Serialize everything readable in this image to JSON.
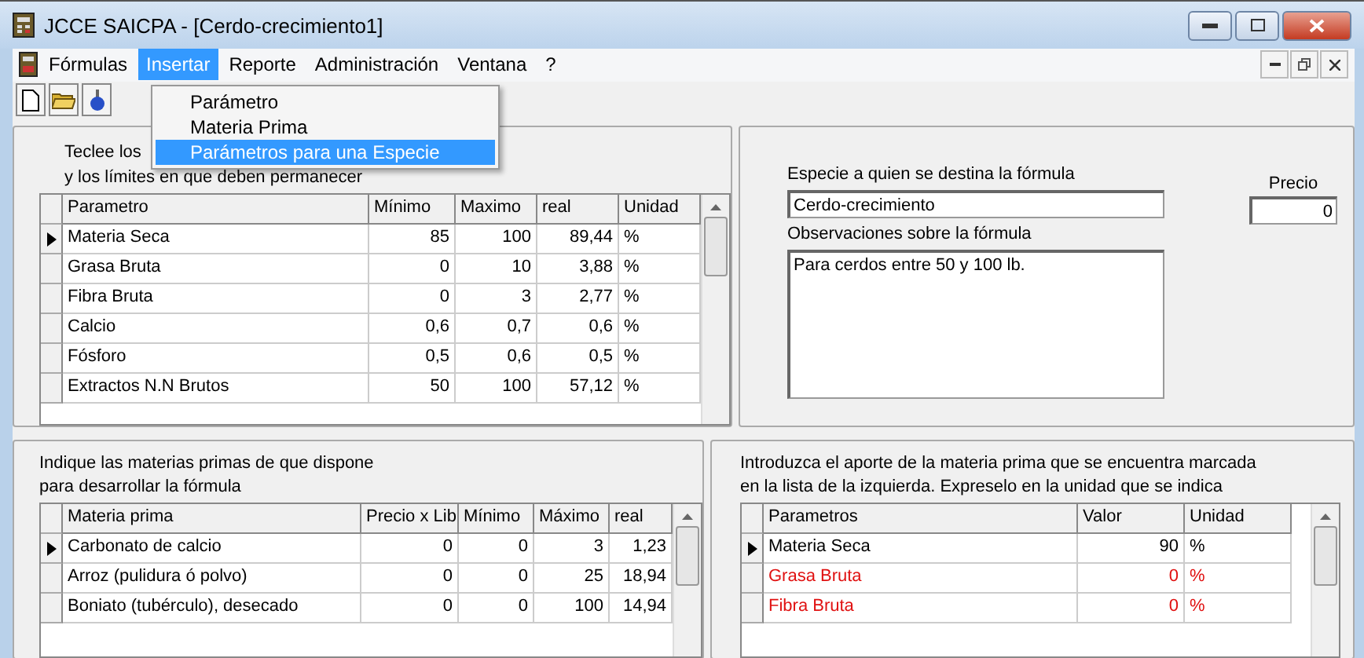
{
  "window": {
    "title": "JCCE SAICPA - [Cerdo-crecimiento1]"
  },
  "menu": [
    {
      "label": "Fórmulas",
      "selected": false
    },
    {
      "label": "Insertar",
      "selected": true
    },
    {
      "label": "Reporte",
      "selected": false
    },
    {
      "label": "Administración",
      "selected": false
    },
    {
      "label": "Ventana",
      "selected": false
    },
    {
      "label": "?",
      "selected": false
    }
  ],
  "dropdown": [
    {
      "label": "Parámetro",
      "selected": false
    },
    {
      "label": "Materia Prima",
      "selected": false
    },
    {
      "label": "Parámetros para una Especie",
      "selected": true
    }
  ],
  "parameters": {
    "intro": [
      "Teclee los",
      "y los límites  en que deben permanecer"
    ],
    "columns": [
      "Parametro",
      "Mínimo",
      "Maximo",
      "real",
      "Unidad"
    ],
    "rows": [
      {
        "cells": [
          "Materia Seca",
          "85",
          "100",
          "89,44",
          "%"
        ],
        "selected": true
      },
      {
        "cells": [
          "Grasa Bruta",
          "0",
          "10",
          "3,88",
          "%"
        ],
        "selected": false
      },
      {
        "cells": [
          "Fibra Bruta",
          "0",
          "3",
          "2,77",
          "%"
        ],
        "selected": false
      },
      {
        "cells": [
          "Calcio",
          "0,6",
          "0,7",
          "0,6",
          "%"
        ],
        "selected": false
      },
      {
        "cells": [
          "Fósforo",
          "0,5",
          "0,6",
          "0,5",
          "%"
        ],
        "selected": false
      },
      {
        "cells": [
          "Extractos N.N Brutos",
          "50",
          "100",
          "57,12",
          "%"
        ],
        "selected": false
      }
    ]
  },
  "species": {
    "label": "Especie a quien se destina la fórmula",
    "value": "Cerdo-crecimiento",
    "notes_label": "Observaciones sobre la fórmula",
    "notes": "Para cerdos entre 50 y 100 lb.",
    "price_label": "Precio",
    "price": "0"
  },
  "materials": {
    "intro": [
      "Indique las materias primas de que dispone",
      "para desarrollar la fórmula"
    ],
    "columns": [
      "Materia prima",
      "Precio x Lib",
      "Mínimo",
      "Máximo",
      "real"
    ],
    "rows": [
      {
        "cells": [
          "Carbonato de calcio",
          "0",
          "0",
          "3",
          "1,23"
        ],
        "selected": true
      },
      {
        "cells": [
          "Arroz (pulidura ó polvo)",
          "0",
          "0",
          "25",
          "18,94"
        ],
        "selected": false
      },
      {
        "cells": [
          "Boniato (tubérculo), desecado",
          "0",
          "0",
          "100",
          "14,94"
        ],
        "selected": false
      }
    ]
  },
  "contribution": {
    "intro": [
      "Introduzca el aporte de la materia prima que se encuentra marcada",
      "en la lista de la izquierda. Expreselo en la unidad que se indica"
    ],
    "columns": [
      "Parametros",
      "Valor",
      "Unidad"
    ],
    "rows": [
      {
        "cells": [
          "Materia Seca",
          "90",
          "%"
        ],
        "selected": true,
        "color": "#000000"
      },
      {
        "cells": [
          "Grasa Bruta",
          "0",
          "%"
        ],
        "selected": false,
        "color": "#e01010"
      },
      {
        "cells": [
          "Fibra Bruta",
          "0",
          "%"
        ],
        "selected": false,
        "color": "#e01010"
      }
    ]
  }
}
